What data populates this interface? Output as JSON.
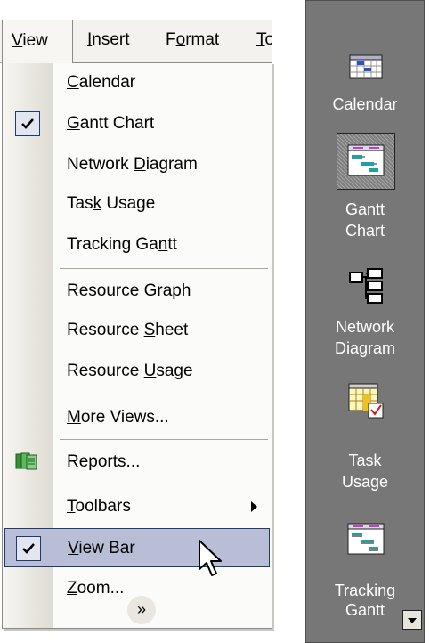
{
  "menubar": {
    "view": {
      "pre": "",
      "key": "V",
      "post": "iew"
    },
    "insert": {
      "pre": "",
      "key": "I",
      "post": "nsert"
    },
    "format": {
      "pre": "F",
      "key": "o",
      "post": "rmat"
    },
    "tools": {
      "pre": "",
      "key": "T",
      "post": "o"
    }
  },
  "menu": {
    "calendar": {
      "pre": "",
      "key": "C",
      "post": "alendar"
    },
    "gantt": {
      "pre": "",
      "key": "G",
      "post": "antt Chart",
      "checked": true
    },
    "network": {
      "pre": "Network ",
      "key": "D",
      "post": "iagram"
    },
    "task_usage": {
      "pre": "Tas",
      "key": "k",
      "post": " Usage"
    },
    "tracking": {
      "pre": "Tracking Ga",
      "key": "n",
      "post": "tt"
    },
    "res_graph": {
      "pre": "Resource Gr",
      "key": "a",
      "post": "ph"
    },
    "res_sheet": {
      "pre": "Resource ",
      "key": "S",
      "post": "heet"
    },
    "res_usage": {
      "pre": "Resource ",
      "key": "U",
      "post": "sage"
    },
    "more_views": {
      "pre": "",
      "key": "M",
      "post": "ore Views..."
    },
    "reports": {
      "pre": "",
      "key": "R",
      "post": "eports..."
    },
    "toolbars": {
      "pre": "",
      "key": "T",
      "post": "oolbars"
    },
    "viewbar": {
      "pre": "",
      "key": "V",
      "post": "iew Bar",
      "checked": true
    },
    "zoom": {
      "pre": "",
      "key": "Z",
      "post": "oom..."
    },
    "expand_glyph": "»"
  },
  "viewbar": {
    "items": [
      {
        "label_line1": "Calendar",
        "label_line2": "",
        "icon": "calendar-icon"
      },
      {
        "label_line1": "Gantt",
        "label_line2": "Chart",
        "icon": "gantt-chart-icon",
        "selected": true
      },
      {
        "label_line1": "Network",
        "label_line2": "Diagram",
        "icon": "network-diagram-icon"
      },
      {
        "label_line1": "Task",
        "label_line2": "Usage",
        "icon": "task-usage-icon"
      },
      {
        "label_line1": "Tracking",
        "label_line2": "Gantt",
        "icon": "tracking-gantt-icon"
      }
    ]
  },
  "colors": {
    "highlight": "#b7bed6",
    "highlight_border": "#1e3a70",
    "viewbar_bg": "#777777"
  }
}
